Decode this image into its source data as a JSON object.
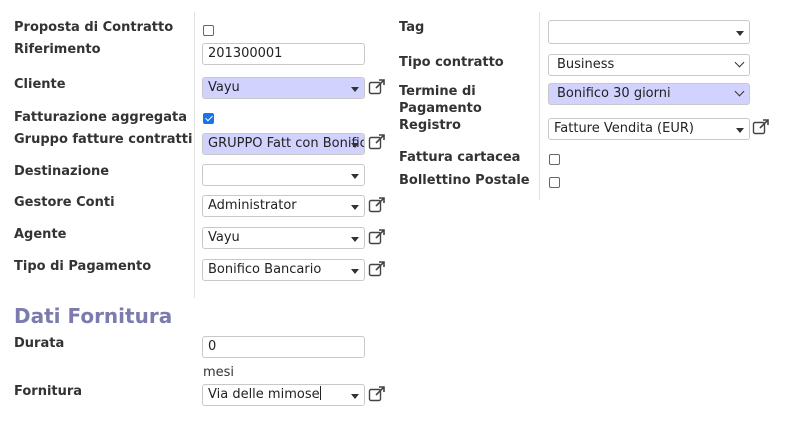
{
  "left": {
    "proposta_label": "Proposta di Contratto",
    "riferimento_label": "Riferimento",
    "riferimento_value": "201300001",
    "cliente_label": "Cliente",
    "cliente_value": "Vayu",
    "fatt_aggr_label": "Fatturazione aggregata",
    "gruppo_label": "Gruppo fatture contratti",
    "gruppo_value": "GRUPPO Fatt con Bonifico",
    "destinazione_label": "Destinazione",
    "destinazione_value": "",
    "gestore_label": "Gestore Conti",
    "gestore_value": "Administrator",
    "agente_label": "Agente",
    "agente_value": "Vayu",
    "tipo_pag_label": "Tipo di Pagamento",
    "tipo_pag_value": "Bonifico Bancario"
  },
  "right": {
    "tag_label": "Tag",
    "tag_value": "",
    "tipo_contratto_label": "Tipo contratto",
    "tipo_contratto_value": "Business",
    "termine_label_1": "Termine di",
    "termine_label_2": "Pagamento",
    "termine_value": "Bonifico 30 giorni",
    "registro_label": "Registro",
    "registro_value": "Fatture Vendita (EUR)",
    "fattura_cartacea_label": "Fattura cartacea",
    "bollettino_label": "Bollettino Postale"
  },
  "fornitura_section": {
    "title": "Dati Fornitura",
    "durata_label": "Durata",
    "durata_value": "0",
    "durata_unit": "mesi",
    "fornitura_label": "Fornitura",
    "fornitura_value": "Via delle mimose"
  },
  "checkboxes": {
    "proposta": false,
    "fatturazione_aggregata": true,
    "fattura_cartacea": false,
    "bollettino_postale": false
  },
  "colors": {
    "required_field": "#d2d2ff",
    "section_title": "#7c7bad",
    "external_link_icon": "#444444"
  }
}
